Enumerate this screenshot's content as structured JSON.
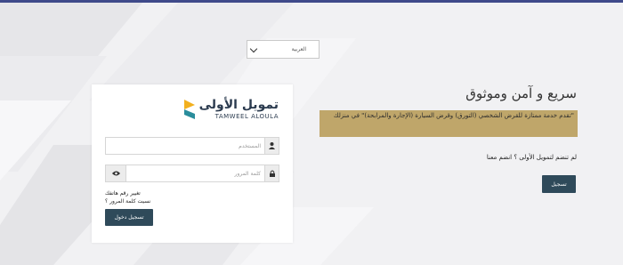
{
  "language_select": {
    "value": "العربية"
  },
  "login": {
    "brand_ar": "تمويل الأولى",
    "brand_en": "TAMWEEL ALOULA",
    "username_placeholder": "المستخدم",
    "password_placeholder": "كلمة المرور",
    "change_phone_link": "تغيير رقم هاتفك",
    "forgot_password_link": "نسيت كلمة المرور ؟",
    "login_button": "تسجيل دخول"
  },
  "promo": {
    "headline": "سريع و آمن وموثوق",
    "tagline": "\"تقدم خدمة ممتازة للقرض الشخصي (التورق) وقرض السيارة (الإجارة والمرابحة)\" في منزلك",
    "signup_prompt": "لم تنضم لتمويل الأولى ؟ انضم معنا",
    "signup_button": "تسجيل"
  },
  "colors": {
    "topbar": "#3f4a8a",
    "button": "#2f4a5a",
    "tagline_bg": "#bfa66a",
    "brand_text": "#2b3b4f",
    "logo_yellow": "#f2b01e",
    "logo_teal": "#2a8d9c"
  },
  "icons": {
    "user": "user-icon",
    "lock": "lock-icon",
    "eye": "eye-icon",
    "chevron": "chevron-down-icon"
  }
}
